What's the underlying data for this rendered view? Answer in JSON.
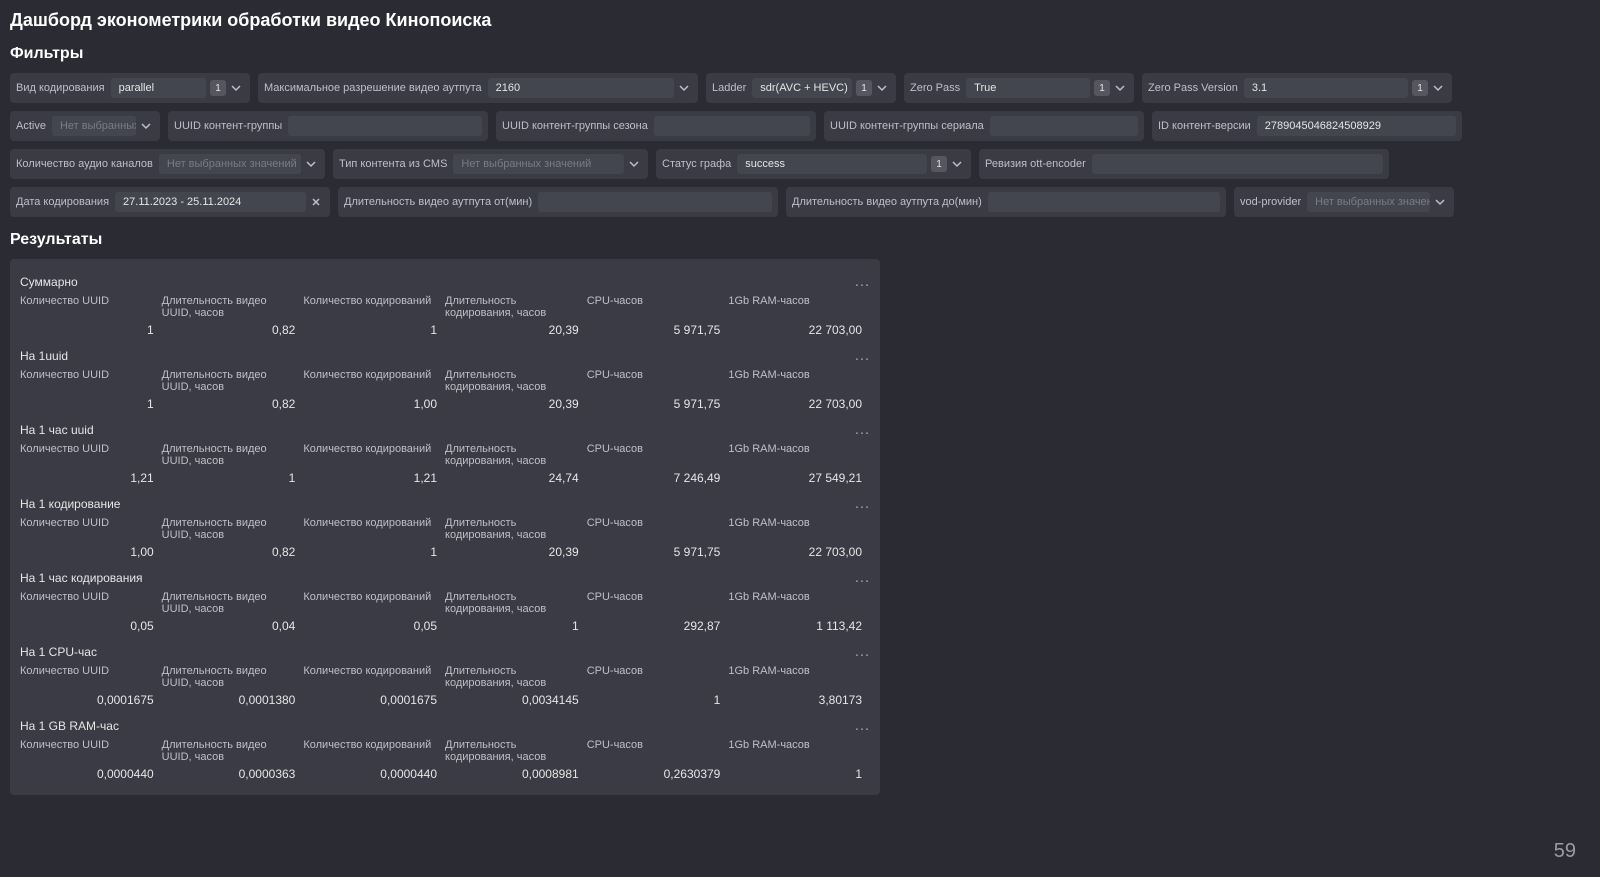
{
  "title": "Дашборд эконометрики обработки видео Кинопоиска",
  "filters_heading": "Фильтры",
  "results_heading": "Результаты",
  "page_number": "59",
  "ph_none_selected_vals": "Нет выбранных значений",
  "ph_none_selected_short": "Нет выбранных з…",
  "filters": {
    "encoding_type": {
      "label": "Вид кодирования",
      "value": "parallel",
      "badge": "1"
    },
    "max_res": {
      "label": "Максимальное разрешение видео аутпута",
      "value": "2160"
    },
    "ladder": {
      "label": "Ladder",
      "value": "sdr(AVC + HEVC)",
      "badge": "1"
    },
    "zero_pass": {
      "label": "Zero Pass",
      "value": "True",
      "badge": "1"
    },
    "zero_pass_ver": {
      "label": "Zero Pass Version",
      "value": "3.1",
      "badge": "1"
    },
    "active": {
      "label": "Active"
    },
    "uuid_group": {
      "label": "UUID контент-группы"
    },
    "uuid_season": {
      "label": "UUID контент-группы сезона"
    },
    "uuid_serial": {
      "label": "UUID контент-группы сериала"
    },
    "content_ver_id": {
      "label": "ID контент-версии",
      "value": "2789045046824508929"
    },
    "audio_channels": {
      "label": "Количество аудио каналов"
    },
    "cms_type": {
      "label": "Тип контента из CMS"
    },
    "graph_status": {
      "label": "Статус графа",
      "value": "success",
      "badge": "1"
    },
    "ott_revision": {
      "label": "Ревизия ott-encoder"
    },
    "encode_date": {
      "label": "Дата кодирования",
      "value": "27.11.2023 - 25.11.2024"
    },
    "out_dur_from": {
      "label": "Длительность видео аутпута от(мин)"
    },
    "out_dur_to": {
      "label": "Длительность видео аутпута до(мин)"
    },
    "vod_provider": {
      "label": "vod-provider"
    }
  },
  "result_columns": [
    "Количество UUID",
    "Длительность видео UUID, часов",
    "Количество кодирований",
    "Длительность кодирования, часов",
    "CPU-часов",
    "1Gb RAM-часов"
  ],
  "result_groups": [
    {
      "title": "Суммарно",
      "values": [
        "1",
        "0,82",
        "1",
        "20,39",
        "5 971,75",
        "22 703,00"
      ]
    },
    {
      "title": "На 1uuid",
      "values": [
        "1",
        "0,82",
        "1,00",
        "20,39",
        "5 971,75",
        "22 703,00"
      ]
    },
    {
      "title": "На 1 час uuid",
      "values": [
        "1,21",
        "1",
        "1,21",
        "24,74",
        "7 246,49",
        "27 549,21"
      ]
    },
    {
      "title": "На 1 кодирование",
      "values": [
        "1,00",
        "0,82",
        "1",
        "20,39",
        "5 971,75",
        "22 703,00"
      ]
    },
    {
      "title": "На 1 час кодирования",
      "values": [
        "0,05",
        "0,04",
        "0,05",
        "1",
        "292,87",
        "1 113,42"
      ]
    },
    {
      "title": "На 1 CPU-час",
      "values": [
        "0,0001675",
        "0,0001380",
        "0,0001675",
        "0,0034145",
        "1",
        "3,80173"
      ]
    },
    {
      "title": "На 1 GB RAM-час",
      "values": [
        "0,0000440",
        "0,0000363",
        "0,0000440",
        "0,0008981",
        "0,2630379",
        "1"
      ]
    }
  ]
}
